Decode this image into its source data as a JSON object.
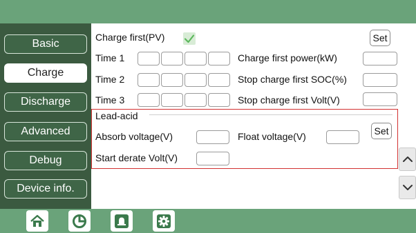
{
  "sidebar": {
    "items": [
      {
        "label": "Basic"
      },
      {
        "label": "Charge"
      },
      {
        "label": "Discharge"
      },
      {
        "label": "Advanced"
      },
      {
        "label": "Debug"
      },
      {
        "label": "Device info."
      }
    ],
    "active": "Charge"
  },
  "charge": {
    "charge_first_pv_label": "Charge first(PV)",
    "charge_first_pv_checked": true,
    "set_label": "Set",
    "time1_label": "Time 1",
    "time2_label": "Time 2",
    "time3_label": "Time 3",
    "charge_first_power_label": "Charge first power(kW)",
    "stop_charge_soc_label": "Stop charge first SOC(%)",
    "stop_charge_volt_label": "Stop charge first Volt(V)",
    "charge_first_power_value": "",
    "stop_charge_soc_value": "",
    "stop_charge_volt_value": ""
  },
  "lead_acid": {
    "title": "Lead-acid",
    "absorb_voltage_label": "Absorb voltage(V)",
    "float_voltage_label": "Float voltage(V)",
    "start_derate_volt_label": "Start derate Volt(V)",
    "absorb_voltage_value": "",
    "float_voltage_value": "",
    "start_derate_volt_value": "",
    "set_label": "Set"
  },
  "bottom_nav": [
    "home-icon",
    "chart-icon",
    "alarm-bell-icon",
    "settings-gear-icon"
  ],
  "colors": {
    "bar_green": "#6aa37a",
    "sidebar_dark": "#3b5a40",
    "highlight_red": "#d23030",
    "check_green": "#5cb85c"
  }
}
